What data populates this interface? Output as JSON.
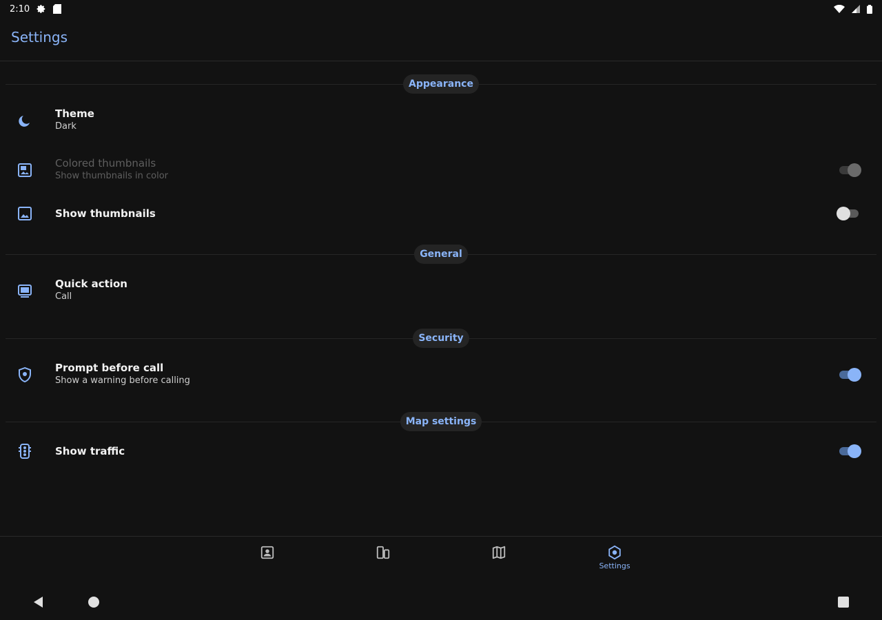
{
  "status_bar": {
    "time": "2:10",
    "left_icons": [
      "gear-icon",
      "sd-card-icon"
    ],
    "right_icons": [
      "wifi-icon",
      "signal-icon",
      "battery-icon"
    ]
  },
  "app_bar": {
    "title": "Settings"
  },
  "colors": {
    "accent": "#8ab4f8",
    "background": "#121212",
    "chip_background": "#242424"
  },
  "sections": {
    "appearance": {
      "header": "Appearance",
      "theme": {
        "icon": "moon-icon",
        "title": "Theme",
        "subtitle": "Dark"
      },
      "colored_thumbnails": {
        "icon": "colored-image-icon",
        "title": "Colored thumbnails",
        "subtitle": "Show thumbnails in color",
        "enabled": false,
        "checked": true
      },
      "show_thumbnails": {
        "icon": "image-icon",
        "title": "Show thumbnails",
        "checked": false
      }
    },
    "general": {
      "header": "General",
      "quick_action": {
        "icon": "quick-action-icon",
        "title": "Quick action",
        "subtitle": "Call"
      }
    },
    "security": {
      "header": "Security",
      "prompt_before_call": {
        "icon": "shield-icon",
        "title": "Prompt before call",
        "subtitle": "Show a warning before calling",
        "checked": true
      }
    },
    "map_settings": {
      "header": "Map settings",
      "show_traffic": {
        "icon": "traffic-light-icon",
        "title": "Show traffic",
        "checked": true
      }
    }
  },
  "bottom_nav": {
    "items": [
      {
        "icon": "contacts-icon",
        "label": ""
      },
      {
        "icon": "devices-icon",
        "label": ""
      },
      {
        "icon": "map-icon",
        "label": ""
      },
      {
        "icon": "settings-icon",
        "label": "Settings",
        "selected": true
      }
    ]
  },
  "system_nav": {
    "buttons": [
      "back-icon",
      "home-icon",
      "recents-icon"
    ]
  }
}
